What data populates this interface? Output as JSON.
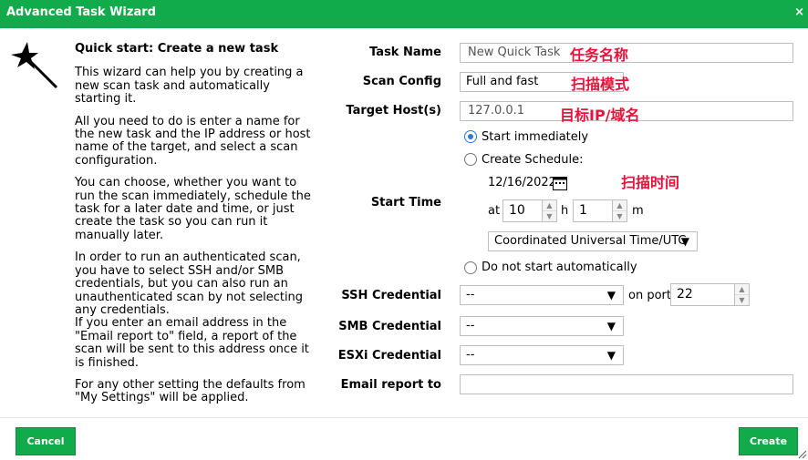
{
  "dialog": {
    "title": "Advanced Task Wizard",
    "close_label": "×"
  },
  "help": {
    "heading": "Quick start: Create a new task",
    "paragraphs": [
      "This wizard can help you by creating a new scan task and automatically starting it.",
      "All you need to do is enter a name for the new task and the IP address or host name of the target, and select a scan configuration.",
      "You can choose, whether you want to run the scan immediately, schedule the task for a later date and time, or just create the task so you can run it manually later.",
      "In order to run an authenticated scan, you have to select SSH and/or SMB credentials, but you can also run an unauthenticated scan by not selecting any credentials.",
      "If you enter an email address in the \"Email report to\" field, a report of the scan will be sent to this address once it is finished.",
      "For any other setting the defaults from \"My Settings\" will be applied."
    ]
  },
  "form": {
    "task_name": {
      "label": "Task Name",
      "value": "New Quick Task",
      "annotation": "任务名称"
    },
    "scan_config": {
      "label": "Scan Config",
      "value": "Full and fast",
      "annotation": "扫描模式"
    },
    "target_hosts": {
      "label": "Target Host(s)",
      "value": "127.0.0.1",
      "annotation": "目标IP/域名"
    },
    "start_time": {
      "label": "Start Time",
      "option_immediately": "Start immediately",
      "option_schedule": "Create Schedule:",
      "option_none": "Do not start automatically",
      "selected": "Start immediately",
      "date": "12/16/2022",
      "annotation": "扫描时间",
      "at_label": "at",
      "hour": "10",
      "hour_unit": "h",
      "minute": "1",
      "minute_unit": "m",
      "timezone": "Coordinated Universal Time/UTC"
    },
    "ssh_credential": {
      "label": "SSH Credential",
      "value": "--",
      "on_port_label": "on port",
      "port": "22"
    },
    "smb_credential": {
      "label": "SMB Credential",
      "value": "--"
    },
    "esxi_credential": {
      "label": "ESXi Credential",
      "value": "--"
    },
    "email": {
      "label": "Email report to",
      "value": ""
    }
  },
  "footer": {
    "cancel_label": "Cancel",
    "create_label": "Create"
  },
  "colors": {
    "brand": "#11ab4b",
    "annotation": "#e8123a",
    "radio_selected": "#2a7bd4"
  },
  "icons": {
    "dropdown": "▼",
    "spinner_up": "▲",
    "spinner_down": "▼"
  }
}
